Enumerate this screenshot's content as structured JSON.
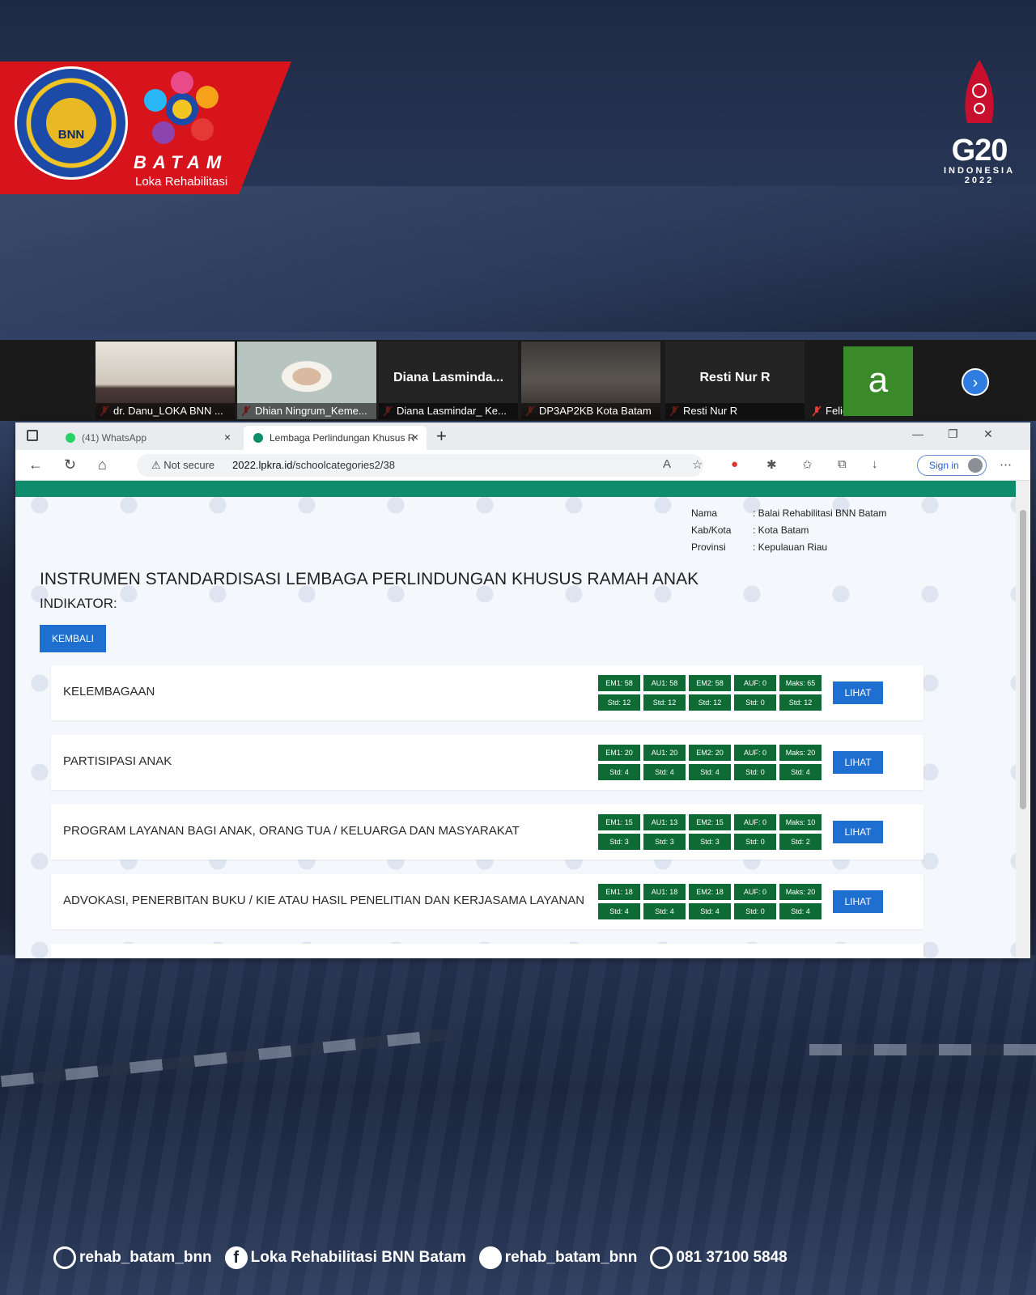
{
  "branding": {
    "seal_text": "BNN",
    "city": "BATAM",
    "subtitle": "Loka Rehabilitasi",
    "g20_title": "G20",
    "g20_country": "INDONESIA",
    "g20_year": "2022"
  },
  "meeting": {
    "participants": [
      {
        "name": "dr. Danu_LOKA BNN ...",
        "type": "video"
      },
      {
        "name": "Dhian Ningrum_Keme...",
        "type": "video"
      },
      {
        "name": "Diana Lasmindar_ Ke...",
        "display": "Diana  Lasminda...",
        "type": "name"
      },
      {
        "name": "DP3AP2KB Kota Batam",
        "type": "video"
      },
      {
        "name": "Resti Nur R",
        "display": "Resti Nur R",
        "type": "name"
      },
      {
        "name": "Felice K",
        "initial": "a",
        "type": "avatar"
      }
    ]
  },
  "browser": {
    "tabs": [
      {
        "label": "(41) WhatsApp"
      },
      {
        "label": "Lembaga Perlindungan Khusus R"
      }
    ],
    "security": "Not secure",
    "url_host": "2022.lpkra.id",
    "url_path": "/schoolcategories2/38",
    "signin": "Sign in"
  },
  "page": {
    "info": [
      {
        "key": "Nama",
        "value": ": Balai Rehabilitasi BNN Batam"
      },
      {
        "key": "Kab/Kota",
        "value": ": Kota Batam"
      },
      {
        "key": "Provinsi",
        "value": ": Kepulauan Riau"
      }
    ],
    "title": "INSTRUMEN STANDARDISASI LEMBAGA PERLINDUNGAN KHUSUS RAMAH ANAK",
    "indikator": "INDIKATOR:",
    "back_button": "KEMBALI",
    "view_button": "LIHAT",
    "categories": [
      {
        "label": "KELEMBAGAAN",
        "top": [
          "EM1: 58",
          "AU1: 58",
          "EM2: 58",
          "AUF: 0",
          "Maks: 65"
        ],
        "bottom": [
          "Std: 12",
          "Std: 12",
          "Std: 12",
          "Std: 0",
          "Std: 12"
        ]
      },
      {
        "label": "PARTISIPASI ANAK",
        "top": [
          "EM1: 20",
          "AU1: 20",
          "EM2: 20",
          "AUF: 0",
          "Maks: 20"
        ],
        "bottom": [
          "Std: 4",
          "Std: 4",
          "Std: 4",
          "Std: 0",
          "Std: 4"
        ]
      },
      {
        "label": "PROGRAM LAYANAN BAGI ANAK, ORANG TUA / KELUARGA DAN MASYARAKAT",
        "top": [
          "EM1: 15",
          "AU1: 13",
          "EM2: 15",
          "AUF: 0",
          "Maks: 10"
        ],
        "bottom": [
          "Std: 3",
          "Std: 3",
          "Std: 3",
          "Std: 0",
          "Std: 2"
        ]
      },
      {
        "label": "ADVOKASI, PENERBITAN BUKU / KIE ATAU HASIL PENELITIAN DAN KERJASAMA LAYANAN",
        "top": [
          "EM1: 18",
          "AU1: 18",
          "EM2: 18",
          "AUF: 0",
          "Maks: 20"
        ],
        "bottom": [
          "Std: 4",
          "Std: 4",
          "Std: 4",
          "Std: 0",
          "Std: 4"
        ]
      }
    ]
  },
  "footer": {
    "instagram": "rehab_batam_bnn",
    "facebook": "Loka Rehabilitasi BNN Batam",
    "twitter": "rehab_batam_bnn",
    "whatsapp": "081 37100 5848"
  },
  "colors": {
    "brand_red": "#d7141c",
    "accent_blue": "#1f6fd1",
    "badge_green": "#0f6b35",
    "header_teal": "#0f8b6e"
  }
}
